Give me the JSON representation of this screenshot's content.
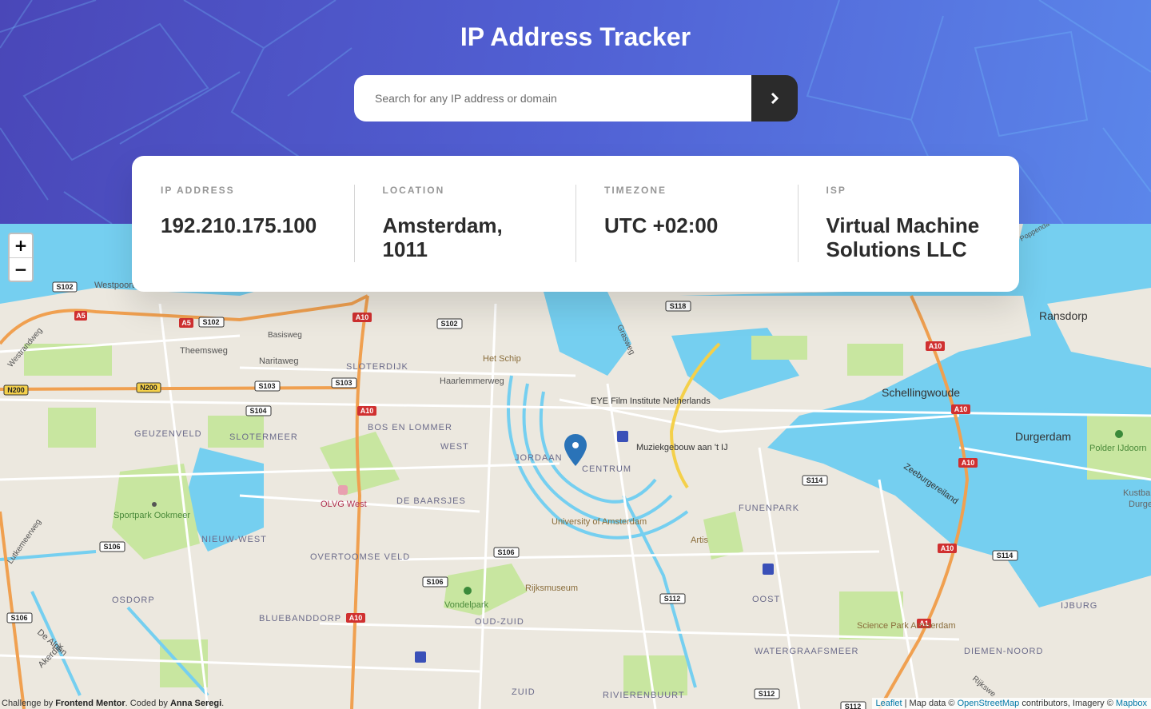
{
  "header": {
    "title": "IP Address Tracker",
    "search_placeholder": "Search for any IP address or domain",
    "search_value": "",
    "submit_icon": "chevron-right-icon"
  },
  "info": {
    "ip_label": "IP ADDRESS",
    "ip_value": "192.210.175.100",
    "location_label": "LOCATION",
    "location_value": "Amsterdam, 1011",
    "timezone_label": "TIMEZONE",
    "timezone_value": "UTC +02:00",
    "isp_label": "ISP",
    "isp_value": "Virtual Machine Solutions LLC"
  },
  "map": {
    "zoom_in": "+",
    "zoom_out": "−",
    "labels": {
      "ransdorp": "Ransdorp",
      "schellingwoude": "Schellingwoude",
      "durgerdam": "Durgerdam",
      "polder": "Polder IJdoorn",
      "het_schip": "Het Schip",
      "haarlemmerweg": "Haarlemmerweg",
      "sloterdijk": "SLOTERDIJK",
      "theemsweg": "Theemsweg",
      "naritaweg": "Naritaweg",
      "basisweg": "Basisweg",
      "westpoort": "Westpoort",
      "geuzenveld": "GEUZENVELD",
      "slotermeer": "SLOTERMEER",
      "bos_en_lommer": "BOS EN LOMMER",
      "west": "WEST",
      "jordaan": "JORDAAN",
      "centrum": "CENTRUM",
      "eye": "EYE Film Institute Netherlands",
      "muziekgebouw": "Muziekgebouw aan 't IJ",
      "zeeburgereiland": "Zeeburgereiland",
      "sportpark": "Sportpark Ookmeer",
      "olvg": "OLVG West",
      "de_baarsjes": "DE BAARSJES",
      "nieuw_west": "NIEUW-WEST",
      "overtoomse_veld": "OVERTOOMSE VELD",
      "university": "University of Amsterdam",
      "artis": "Artis",
      "funenpark": "FUNENPARK",
      "osdorp": "OSDORP",
      "vondelpark": "Vondelpark",
      "rijksmuseum": "Rijksmuseum",
      "oud_zuid": "OUD-ZUID",
      "bluebanddorp": "BLUEBANDDORP",
      "oost": "OOST",
      "ijburg": "IJBURG",
      "science_park": "Science Park Amsterdam",
      "watergraafsmeer": "WATERGRAAFSMEER",
      "diemen_noord": "DIEMEN-NOORD",
      "zuid": "ZUID",
      "rivierenbuurt": "RIVIERENBUURT",
      "de_alpen": "De Alpen",
      "akerdijk": "Akerdijk",
      "lutkemeerweg": "Lutkemeerweg",
      "westrandweg": "Westrandweg",
      "grasweg": "Grasweg",
      "rijkswe": "Rijkswe",
      "poppendam": "Poppenda",
      "kustba": "Kustba",
      "durge": "Durge"
    },
    "shields": {
      "s102a": "S102",
      "s102b": "S102",
      "s102c": "S102",
      "a5a": "A5",
      "a5b": "A5",
      "a10a": "A10",
      "a10b": "A10",
      "a10c": "A10",
      "a10d": "A10",
      "a10e": "A10",
      "a10f": "A10",
      "a10g": "A10",
      "s103a": "S103",
      "s103b": "S103",
      "s104": "S104",
      "s118": "S118",
      "n200a": "N200",
      "n200b": "N200",
      "s114a": "S114",
      "s114b": "S114",
      "s106a": "S106",
      "s106b": "S106",
      "s106c": "S106",
      "s106d": "S106",
      "s112a": "S112",
      "s112b": "S112",
      "s112c": "S112",
      "a1": "A1"
    }
  },
  "attribution": {
    "leaflet": "Leaflet",
    "text": " | Map data © ",
    "osm": "OpenStreetMap",
    "text2": " contributors, Imagery © ",
    "mapbox": "Mapbox"
  },
  "credit": {
    "prefix": "Challenge by ",
    "fm": "Frontend Mentor",
    "mid": ". Coded by ",
    "author": "Anna Seregi",
    "suffix": "."
  },
  "colors": {
    "accent": "#2b2b2b",
    "water": "#75cff0",
    "park": "#c8e6a0",
    "motorway": "#f0a050",
    "marker": "#2a73b8"
  }
}
